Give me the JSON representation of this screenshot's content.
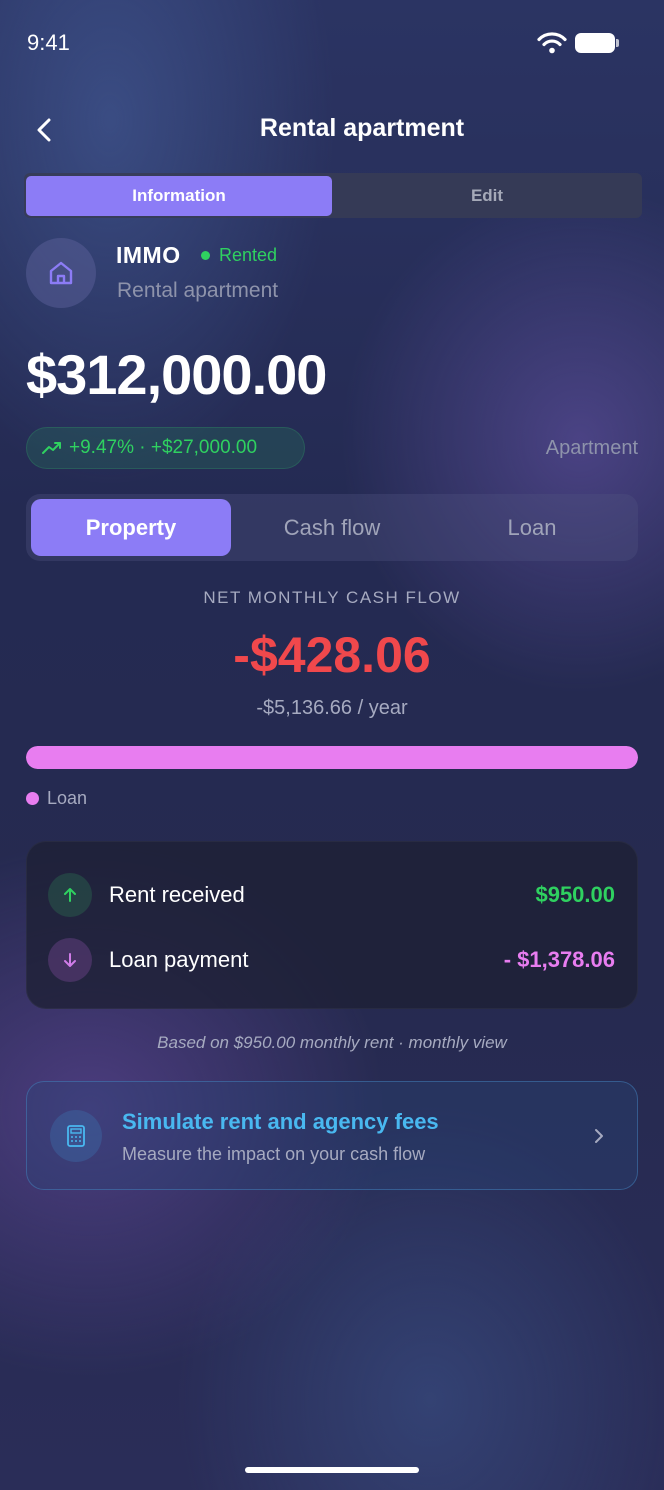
{
  "status_bar": {
    "time": "9:41"
  },
  "header": {
    "title": "Rental apartment"
  },
  "top_segment": {
    "items": [
      "Information",
      "Edit"
    ],
    "selected": "Information"
  },
  "property": {
    "name": "IMMO",
    "status": "Rented",
    "subtitle": "Rental apartment",
    "value": "$312,000.00",
    "change": "+9.47% · +$27,000.00",
    "type": "Apartment"
  },
  "main_tabs": {
    "items": [
      "Property",
      "Cash flow",
      "Loan"
    ],
    "selected": "Property"
  },
  "cash_flow": {
    "label": "NET MONTHLY CASH FLOW",
    "amount": "-$428.06",
    "yearly": "-$5,136.66 / year",
    "bar_fill_percent": 100,
    "legend_label": "Loan"
  },
  "breakdown": {
    "rows": [
      {
        "label": "Rent received",
        "value": "$950.00",
        "icon": "arrow-up-icon"
      },
      {
        "label": "Loan payment",
        "value": "- $1,378.06",
        "icon": "arrow-down-icon"
      }
    ]
  },
  "footnote": "Based on $950.00 monthly rent · monthly view",
  "simulate": {
    "title": "Simulate rent and agency fees",
    "subtitle": "Measure the impact on your cash flow",
    "icon": "calculator-icon"
  },
  "colors": {
    "accent": "#8c7cf6",
    "positive": "#2fd160",
    "negative": "#f0484c",
    "loan": "#e87df0",
    "info": "#49b8f0"
  }
}
